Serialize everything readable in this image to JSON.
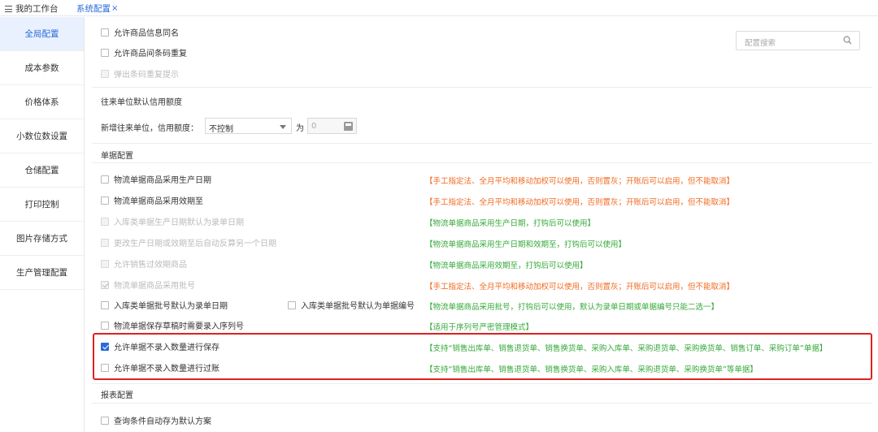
{
  "topbar": {
    "menu_label": "我的工作台",
    "tab_label": "系统配置",
    "tab_close": "×"
  },
  "sidebar": {
    "items": [
      {
        "label": "全局配置"
      },
      {
        "label": "成本参数"
      },
      {
        "label": "价格体系"
      },
      {
        "label": "小数位数设置"
      },
      {
        "label": "仓储配置"
      },
      {
        "label": "打印控制"
      },
      {
        "label": "图片存储方式"
      },
      {
        "label": "生产管理配置"
      }
    ]
  },
  "search": {
    "placeholder": "配置搜索"
  },
  "general": {
    "opt1": "允许商品信息同名",
    "opt2": "允许商品间条码重复",
    "opt3": "弹出条码重复提示"
  },
  "credit": {
    "section_title": "往来单位默认信用额度",
    "label": "新增往来单位，信用额度：",
    "select_value": "不控制",
    "for_label": "为",
    "amount_value": "0"
  },
  "docs": {
    "section_title": "单据配置",
    "items": [
      {
        "label": "物流单据商品采用生产日期",
        "note": "【手工指定法、全月平均和移动加权可以使用，否则置灰；开账后可以启用，但不能取消】"
      },
      {
        "label": "物流单据商品采用效期至",
        "note": "【手工指定法、全月平均和移动加权可以使用，否则置灰；开账后可以启用，但不能取消】"
      },
      {
        "label": "入库类单据生产日期默认为录单日期",
        "note": "【物流单据商品采用生产日期，打钩后可以使用】"
      },
      {
        "label": "更改生产日期或效期至后自动反算另一个日期",
        "note": "【物流单据商品采用生产日期和效期至，打钩后可以使用】"
      },
      {
        "label": "允许销售过效期商品",
        "note": "【物流单据商品采用效期至，打钩后可以使用】"
      },
      {
        "label": "物流单据商品采用批号",
        "note": "【手工指定法、全月平均和移动加权可以使用，否则置灰；开账后可以启用，但不能取消】"
      },
      {
        "label": "入库类单据批号默认为录单日期",
        "label2": "入库类单据批号默认为单据编号",
        "note": "【物流单据商品采用批号，打钩后可以使用，默认为录单日期或单据编号只能二选一】"
      },
      {
        "label": "物流单据保存草稿时需要录入序列号",
        "note": "【适用于序列号严密管理模式】"
      },
      {
        "label": "允许单据不录入数量进行保存",
        "note": "【支持“销售出库单、销售退货单、销售换货单、采购入库单、采购退货单、采购换货单、销售订单、采购订单”单据】"
      },
      {
        "label": "允许单据不录入数量进行过账",
        "note": "【支持“销售出库单、销售退货单、销售换货单、采购入库单、采购退货单、采购换货单”等单据】"
      }
    ]
  },
  "report": {
    "section_title": "报表配置",
    "opt1": "查询条件自动存为默认方案"
  },
  "colors": {
    "accent": "#2b6cd8",
    "orange_note": "#f06a20",
    "green_note": "#35a93a",
    "highlight_border": "#e02020"
  },
  "icons": {
    "menu": "hamburger-icon",
    "search": "search-icon",
    "select": "chevron-down-icon",
    "calc": "calculator-icon"
  }
}
